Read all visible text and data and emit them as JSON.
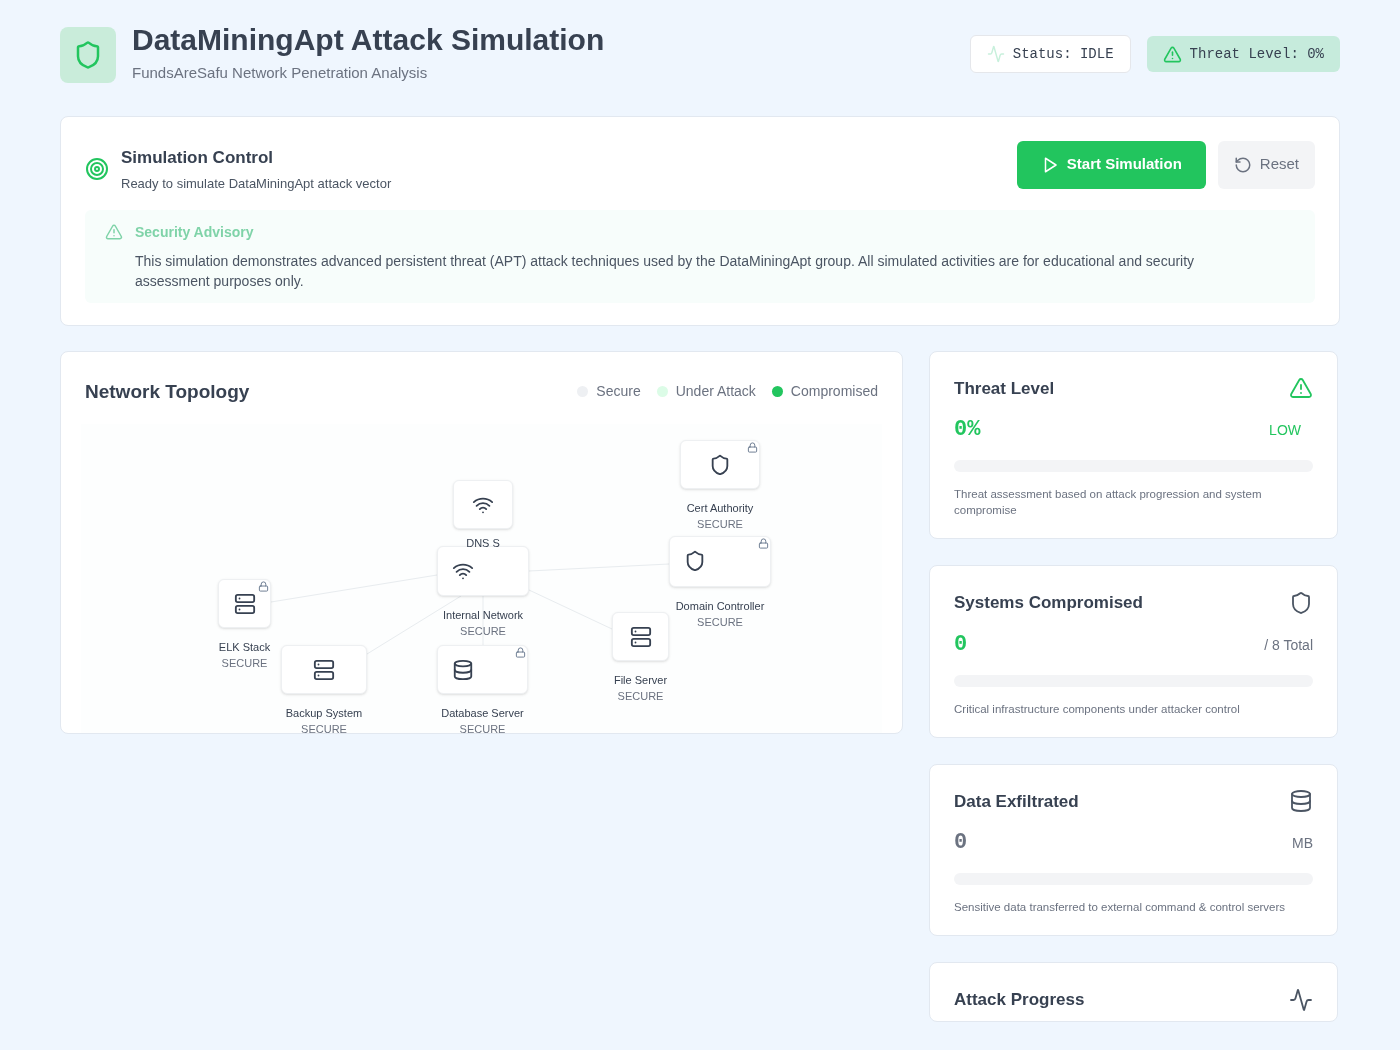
{
  "header": {
    "title": "DataMiningApt Attack Simulation",
    "subtitle": "FundsAreSafu Network Penetration Analysis",
    "status": "Status: IDLE",
    "threat": "Threat Level: 0%"
  },
  "control": {
    "title": "Simulation Control",
    "subtitle": "Ready to simulate DataMiningApt attack vector",
    "buttons": [
      {
        "label": "Start Simulation",
        "kind": "primary"
      },
      {
        "label": "Reset",
        "kind": "secondary"
      }
    ],
    "advisory": {
      "title": "Security Advisory",
      "text": "This simulation demonstrates advanced persistent threat (APT) attack techniques used by the DataMiningApt group. All simulated activities are for educational and security assessment purposes only."
    }
  },
  "topology": {
    "title": "Network Topology",
    "legend": [
      {
        "label": "Secure",
        "color": "#eef0f3"
      },
      {
        "label": "Under Attack",
        "color": "#dcfce7"
      },
      {
        "label": "Compromised",
        "color": "#22c55e"
      }
    ],
    "nodes": [
      {
        "label": "DNS S",
        "kind": "wifi",
        "locked": false
      },
      {
        "label": "Cert Authority",
        "status": "SECURE",
        "kind": "shield",
        "locked": true
      },
      {
        "label": "Domain Controller",
        "status": "SECURE",
        "kind": "shield",
        "locked": true
      },
      {
        "label": "Internal Network",
        "status": "SECURE",
        "kind": "wifi",
        "locked": false
      },
      {
        "label": "ELK Stack",
        "status": "SECURE",
        "kind": "server",
        "locked": true
      },
      {
        "label": "Backup System",
        "status": "SECURE",
        "kind": "server",
        "locked": false
      },
      {
        "label": "Database Server",
        "status": "SECURE",
        "kind": "database",
        "locked": true
      },
      {
        "label": "File Server",
        "status": "SECURE",
        "kind": "server",
        "locked": false
      }
    ]
  },
  "stats": [
    {
      "title": "Threat Level",
      "value": "0%",
      "color": "#22c55e",
      "unit": "LOW",
      "level": 0,
      "description": "Threat assessment based on attack progression and system compromise"
    },
    {
      "title": "Systems Compromised",
      "value": "0",
      "color": "#22c55e",
      "unit": "/ 8 Total",
      "level": 0,
      "description": "Critical infrastructure components under attacker control"
    },
    {
      "title": "Data Exfiltrated",
      "value": "0",
      "color": "#6b7280",
      "unit": "MB",
      "level": 0,
      "description": "Sensitive data transferred to external command & control servers"
    },
    {
      "title": "Attack Progress"
    }
  ]
}
